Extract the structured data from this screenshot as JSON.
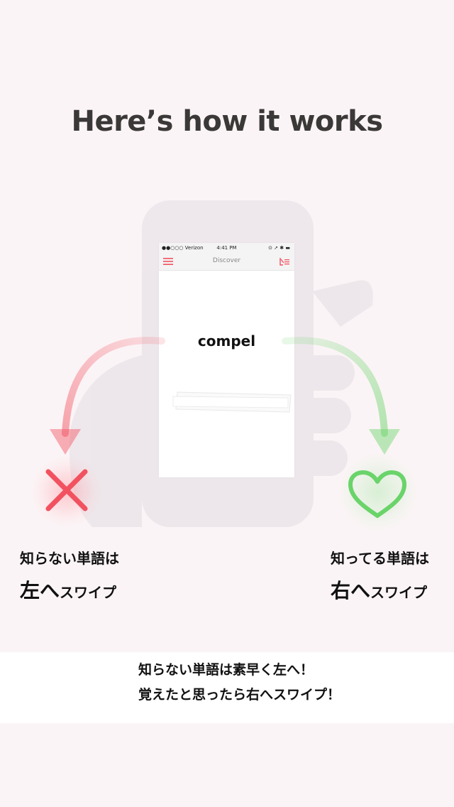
{
  "title": "Here’s how it works",
  "phone": {
    "status": {
      "carrier": "●●○○○ Verizon ",
      "time": "4:41 PM",
      "icons": "⊙ ➚ ✱ ▬"
    },
    "nav_title": "Discover",
    "word": "compel"
  },
  "left": {
    "top_label": "知らない単語は",
    "direction": "左へ",
    "action": "スワイプ"
  },
  "right": {
    "top_label": "知ってる単語は",
    "direction": "右へ",
    "action": "スワイプ"
  },
  "caption": {
    "line1": "知らない単語は素早く左へ！",
    "line2": "覚えたと思ったら右へスワイプ！"
  },
  "colors": {
    "accent_red": "#f25260",
    "accent_green": "#6ad46a",
    "title": "#3b3838"
  }
}
